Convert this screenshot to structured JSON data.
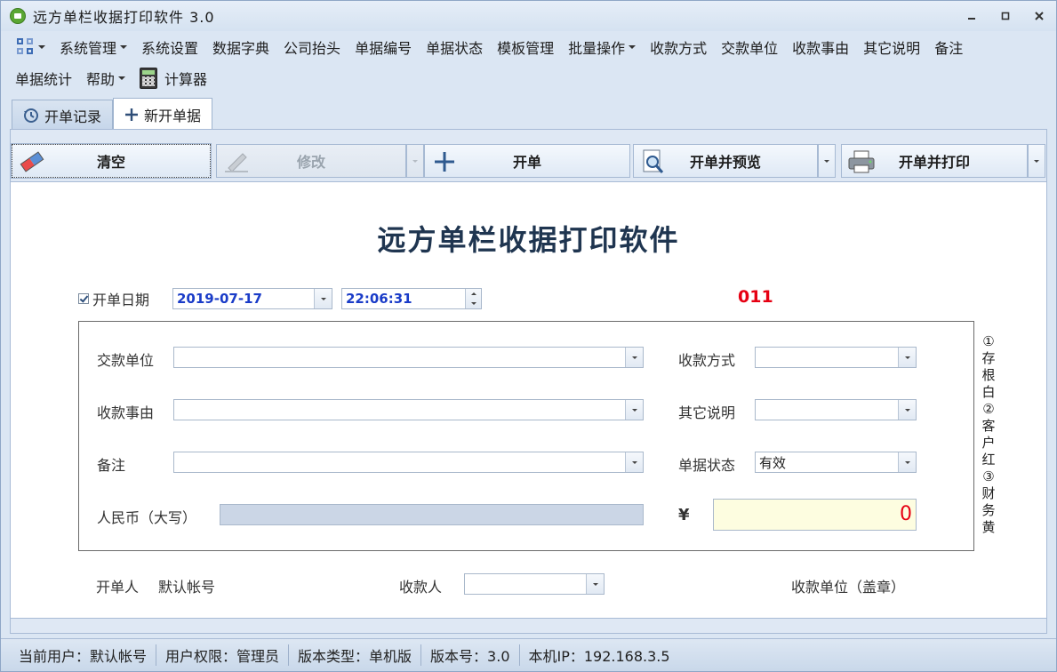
{
  "window": {
    "title": "远方单栏收据打印软件 3.0",
    "icon": "app-printer-icon"
  },
  "menu": {
    "row1": [
      {
        "label": "系统管理",
        "dropdown": true
      },
      {
        "label": "系统设置",
        "dropdown": false
      },
      {
        "label": "数据字典",
        "dropdown": false
      },
      {
        "label": "公司抬头",
        "dropdown": false
      },
      {
        "label": "单据编号",
        "dropdown": false
      },
      {
        "label": "单据状态",
        "dropdown": false
      },
      {
        "label": "模板管理",
        "dropdown": false
      },
      {
        "label": "批量操作",
        "dropdown": true
      },
      {
        "label": "收款方式",
        "dropdown": false
      },
      {
        "label": "交款单位",
        "dropdown": false
      },
      {
        "label": "收款事由",
        "dropdown": false
      },
      {
        "label": "其它说明",
        "dropdown": false
      },
      {
        "label": "备注",
        "dropdown": false
      }
    ],
    "row2": [
      {
        "label": "单据统计",
        "dropdown": false
      },
      {
        "label": "帮助",
        "dropdown": true
      },
      {
        "label": "计算器",
        "dropdown": false
      }
    ]
  },
  "tabs": [
    {
      "label": "开单记录",
      "active": false,
      "icon": "history-icon"
    },
    {
      "label": "新开单据",
      "active": true,
      "icon": "plus-icon"
    }
  ],
  "toolbar": {
    "clear": "清空",
    "modify": "修改",
    "issue": "开单",
    "issue_preview": "开单并预览",
    "issue_print": "开单并打印"
  },
  "form": {
    "title": "远方单栏收据打印软件",
    "date_label": "开单日期",
    "date_value": "2019-07-17",
    "time_value": "22:06:31",
    "doc_number": "011",
    "payer_label": "交款单位",
    "payer_value": "",
    "reason_label": "收款事由",
    "reason_value": "",
    "remark_label": "备注",
    "remark_value": "",
    "amount_cn_label": "人民币（大写）",
    "amount_cn_value": "",
    "method_label": "收款方式",
    "method_value": "",
    "other_label": "其它说明",
    "other_value": "",
    "status_label": "单据状态",
    "status_value": "有效",
    "currency_symbol": "¥",
    "amount_value": "0",
    "side_note": "①存根白②客户红③财务黄",
    "issuer_label": "开单人",
    "issuer_value": "默认帐号",
    "payee_label": "收款人",
    "payee_value": "",
    "seal_label": "收款单位（盖章）"
  },
  "status": [
    "当前用户：默认帐号",
    "用户权限：管理员",
    "版本类型：单机版",
    "版本号：3.0",
    "本机IP：192.168.3.5"
  ],
  "colors": {
    "doc_number": "#e60012",
    "date_text": "#1a3cc8",
    "title": "#1f3550",
    "amount_bg": "#fdfde0"
  }
}
